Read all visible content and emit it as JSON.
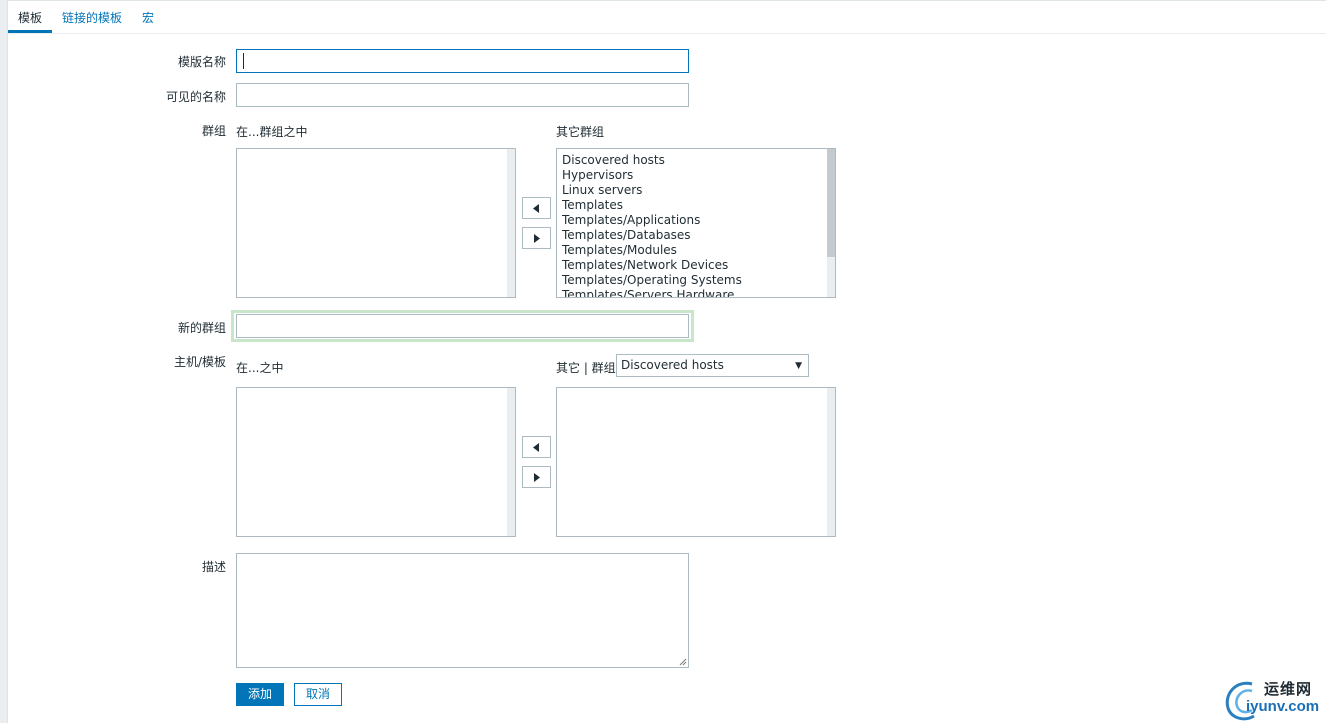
{
  "tabs": [
    {
      "label": "模板",
      "active": true
    },
    {
      "label": "链接的模板",
      "active": false
    },
    {
      "label": "宏",
      "active": false
    }
  ],
  "form": {
    "template_name_label": "模版名称",
    "template_name_value": "",
    "visible_name_label": "可见的名称",
    "visible_name_value": "",
    "groups_label": "群组",
    "in_groups_label": "在...群组之中",
    "other_groups_label": "其它群组",
    "in_groups_items": [],
    "other_groups_items": [
      "Discovered hosts",
      "Hypervisors",
      "Linux servers",
      "Templates",
      "Templates/Applications",
      "Templates/Databases",
      "Templates/Modules",
      "Templates/Network Devices",
      "Templates/Operating Systems",
      "Templates/Servers Hardware"
    ],
    "new_group_label": "新的群组",
    "new_group_value": "",
    "hosts_templates_label": "主机/模板",
    "in_hosts_label": "在...之中",
    "other_group_label": "其它 | 群组",
    "other_group_selected": "Discovered hosts",
    "in_hosts_items": [],
    "other_hosts_items": [],
    "description_label": "描述",
    "description_value": "",
    "add_button": "添加",
    "cancel_button": "取消"
  },
  "watermark": {
    "cn": "运维网",
    "en": "iyunv.com"
  },
  "colors": {
    "accent": "#0275b8",
    "border": "#acbbc2",
    "focus_glow": "#c8e6c9"
  }
}
